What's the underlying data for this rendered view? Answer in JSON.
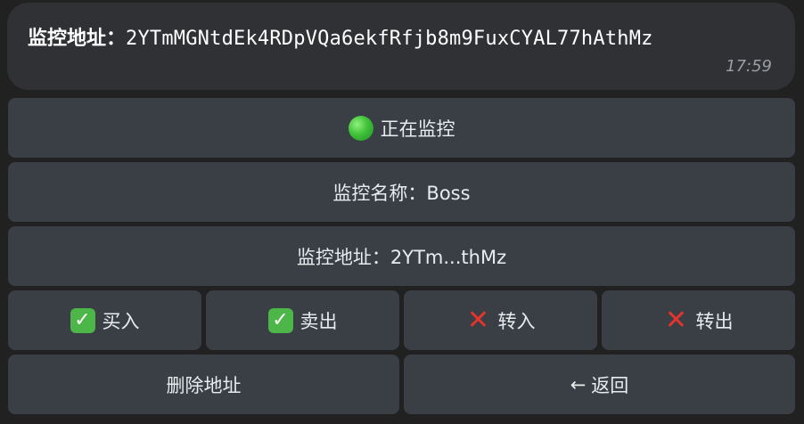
{
  "message": {
    "label": "监控地址：",
    "address": "2YTmMGNtdEk4RDpVQa6ekfRfjb8m9FuxCYAL77hAthMz",
    "time": "17:59"
  },
  "keyboard": {
    "status_label": "正在监控",
    "status_icon": "green-circle-icon",
    "name_label": "监控名称：Boss",
    "address_label": "监控地址：2YTm...thMz",
    "buy_label": "买入",
    "buy_icon": "check-icon",
    "sell_label": "卖出",
    "sell_icon": "check-icon",
    "transfer_in_label": "转入",
    "transfer_in_icon": "cross-icon",
    "transfer_out_label": "转出",
    "transfer_out_icon": "cross-icon",
    "delete_label": "删除地址",
    "back_label": "返回",
    "back_icon": "←"
  },
  "colors": {
    "background": "#212121",
    "bubble": "#2f3134",
    "button": "#3a3f45",
    "check_green": "#4cb648",
    "cross_red": "#e5342d"
  }
}
